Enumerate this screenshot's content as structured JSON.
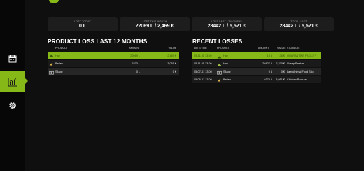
{
  "nav": {
    "items": [
      {
        "name": "calendar-icon"
      },
      {
        "name": "chart-icon"
      },
      {
        "name": "gear-icon"
      }
    ]
  },
  "summary": [
    {
      "label": "LOST TODAY",
      "value": "0 L"
    },
    {
      "label": "LOST THIS MONTH",
      "value": "22069 L / 2,469 €"
    },
    {
      "label": "LOST LAST 12 MONTHS",
      "value": "28442 L / 5,521 €"
    },
    {
      "label": "TOTAL LOST",
      "value": "28442 L / 5,521 €"
    }
  ],
  "product_loss": {
    "title": "PRODUCT LOSS LAST 12 MONTHS",
    "headers": {
      "product": "PRODUCT",
      "amount": "AMOUNT",
      "value": "VALUE"
    },
    "rows": [
      {
        "product": "Hay",
        "amount": "22069 L",
        "value": "2,469 €",
        "icon": "hay-icon"
      },
      {
        "product": "Barley",
        "amount": "6373 L",
        "value": "3,051 €",
        "icon": "barley-icon"
      },
      {
        "product": "Silage",
        "amount": "0 L",
        "value": "0 €",
        "icon": "silage-icon"
      }
    ]
  },
  "recent_losses": {
    "title": "RECENT LOSSES",
    "headers": {
      "date": "DATE/TIME",
      "product": "PRODUCT",
      "amount": "AMOUNT",
      "value": "VALUE",
      "storage": "STORAGE"
    },
    "rows": [
      {
        "date": "05-11-01 13:00",
        "product": "Hay",
        "amount": "13 L",
        "value": "136 €",
        "storage": "Quarantine Facility",
        "icon": "hay-icon"
      },
      {
        "date": "05-11-01 13:00",
        "product": "Hay",
        "amount": "26827 L",
        "value": "2,370 €",
        "storage": "Sheep Pasture",
        "icon": "hay-icon"
      },
      {
        "date": "05-07-01 13:00",
        "product": "Silage",
        "amount": "0 L",
        "value": "0 €",
        "storage": "Lazy Animal Food Silo",
        "icon": "silage-icon"
      },
      {
        "date": "05-06-01 13:00",
        "product": "Barley",
        "amount": "6373 L",
        "value": "3,051 €",
        "storage": "Chicken Pasture",
        "icon": "barley-icon"
      }
    ]
  },
  "colors": {
    "accent": "#86b817",
    "background": "#0f0f0f",
    "card": "#1d1d1d"
  }
}
